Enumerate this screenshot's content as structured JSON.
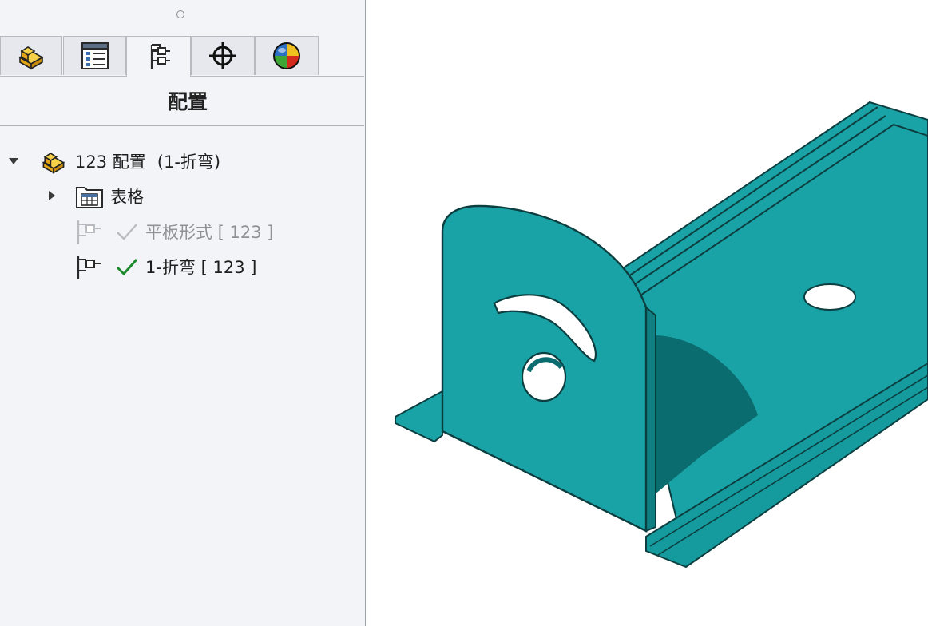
{
  "panel": {
    "title": "配置",
    "tabs": [
      {
        "name": "feature-manager",
        "icon": "part-icon"
      },
      {
        "name": "property-manager",
        "icon": "property-list-icon"
      },
      {
        "name": "configuration-manager",
        "icon": "configuration-tree-icon",
        "active": true
      },
      {
        "name": "dimxpert-manager",
        "icon": "crosshair-icon"
      },
      {
        "name": "display-manager",
        "icon": "appearance-sphere-icon"
      }
    ]
  },
  "tree": {
    "root": {
      "label": "123 配置",
      "detail": "(1-折弯)",
      "icon": "part-icon",
      "expanded": true
    },
    "table": {
      "label": "表格",
      "icon": "table-folder-icon",
      "expanded": false
    },
    "flat_pattern": {
      "label": "平板形式 [ 123 ]",
      "icon": "configuration-icon",
      "state": "inactive"
    },
    "bent": {
      "label": "1-折弯 [ 123 ]",
      "icon": "configuration-icon",
      "state": "active"
    }
  },
  "colors": {
    "model": "#1aa3a6",
    "model_dark": "#0f7f82",
    "shadow": "#0a6c6e",
    "check_active": "#1e8a2e",
    "check_inactive": "#b9bcc0",
    "part_icon": "#f2c12e"
  }
}
